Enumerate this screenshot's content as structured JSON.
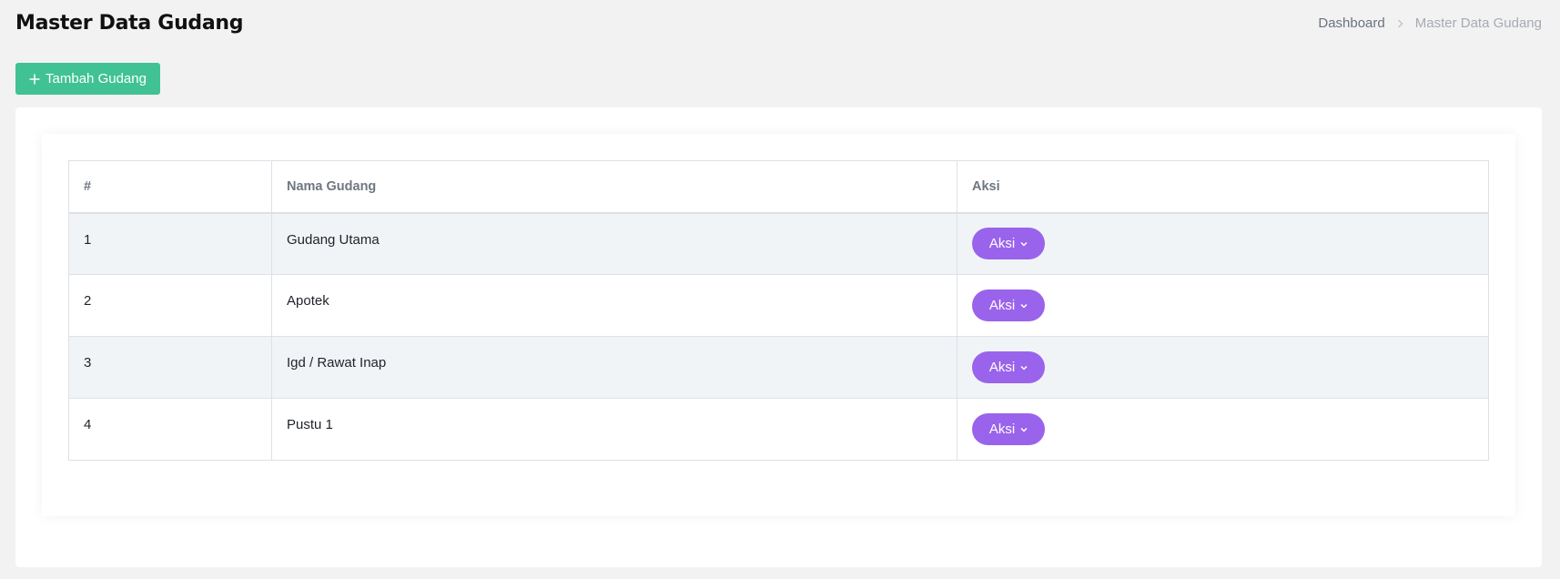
{
  "header": {
    "title": "Master Data Gudang",
    "breadcrumb": {
      "home": "Dashboard",
      "current": "Master Data Gudang"
    }
  },
  "toolbar": {
    "add_label": "Tambah Gudang",
    "add_icon": "plus-icon",
    "accent": "#40c294"
  },
  "table": {
    "columns": [
      "#",
      "Nama Gudang",
      "Aksi"
    ],
    "action_label": "Aksi",
    "action_icon": "chevron-down-icon",
    "action_color": "#9a63ec",
    "rows": [
      {
        "num": "1",
        "name": "Gudang Utama"
      },
      {
        "num": "2",
        "name": "Apotek"
      },
      {
        "num": "3",
        "name": "Igd / Rawat Inap"
      },
      {
        "num": "4",
        "name": "Pustu 1"
      }
    ]
  }
}
